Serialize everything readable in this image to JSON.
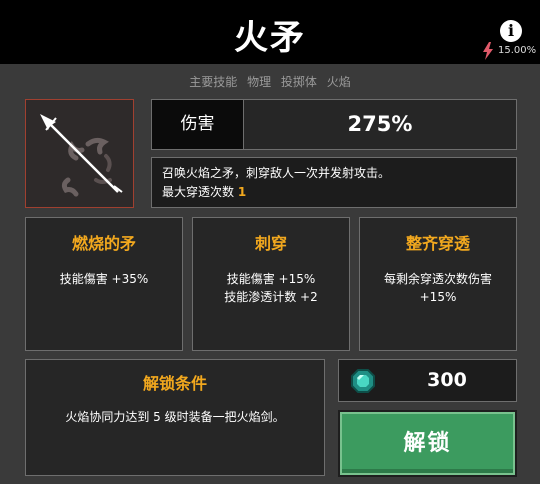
{
  "header": {
    "title": "火矛",
    "info_icon": "info-icon",
    "chance_icon": "lightning-icon",
    "chance_value": "15.00%"
  },
  "tags": [
    "主要技能",
    "物理",
    "投掷体",
    "火焰"
  ],
  "skill": {
    "icon": "fire-spear-icon",
    "damage_label": "伤害",
    "damage_value": "275%",
    "description": "召唤火焰之矛，刺穿敌人一次并发射攻击。",
    "pierce_label": "最大穿透次数",
    "pierce_value": "1"
  },
  "modifiers": [
    {
      "title": "燃烧的矛",
      "lines": [
        "技能傷害 +35%"
      ]
    },
    {
      "title": "刺穿",
      "lines": [
        "技能傷害 +15%",
        "技能渗透计数 +2"
      ]
    },
    {
      "title": "整齐穿透",
      "lines": [
        "每剩余穿透次数伤害",
        "+15%"
      ]
    }
  ],
  "unlock": {
    "title": "解锁条件",
    "condition": "火焰协同力达到 5 级时装备一把火焰剑。",
    "cost_icon": "gem-icon",
    "cost": "300",
    "button_label": "解锁"
  },
  "colors": {
    "accent": "#f2a81e",
    "button": "#3c9b5f",
    "icon_border": "#a04030"
  }
}
